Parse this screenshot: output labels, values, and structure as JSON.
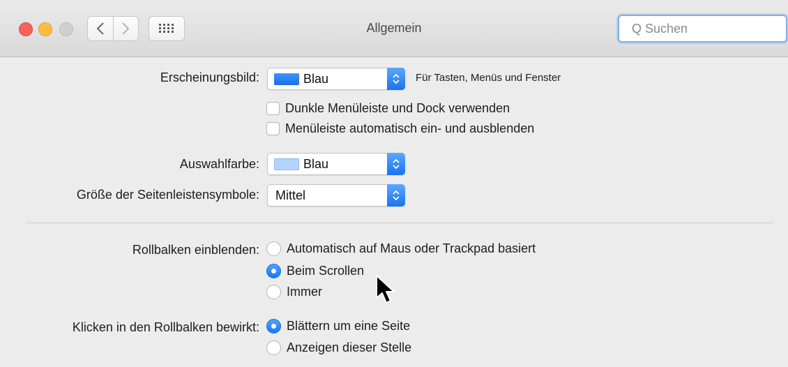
{
  "window": {
    "title": "Allgemein",
    "search_placeholder": "Q Suchen"
  },
  "appearance": {
    "label": "Erscheinungsbild:",
    "value": "Blau",
    "swatch_color": "#1f7cf2",
    "note": "Für Tasten, Menüs und Fenster"
  },
  "menubar_options": [
    {
      "label": "Dunkle Menüleiste und Dock verwenden",
      "checked": false
    },
    {
      "label": "Menüleiste automatisch ein- und ausblenden",
      "checked": false
    }
  ],
  "highlight": {
    "label": "Auswahlfarbe:",
    "value": "Blau",
    "swatch_color": "#b4d4fb"
  },
  "sidebar_size": {
    "label": "Größe der Seitenleistensymbole:",
    "value": "Mittel"
  },
  "scrollbars": {
    "label": "Rollbalken einblenden:",
    "options": [
      {
        "label": "Automatisch auf Maus oder Trackpad basiert",
        "selected": false
      },
      {
        "label": "Beim Scrollen",
        "selected": true
      },
      {
        "label": "Immer",
        "selected": false
      }
    ]
  },
  "scroll_click": {
    "label": "Klicken in den Rollbalken bewirkt:",
    "options": [
      {
        "label": "Blättern um eine Seite",
        "selected": true
      },
      {
        "label": "Anzeigen dieser Stelle",
        "selected": false
      }
    ]
  },
  "colors": {
    "accent": "#1a73ee"
  }
}
